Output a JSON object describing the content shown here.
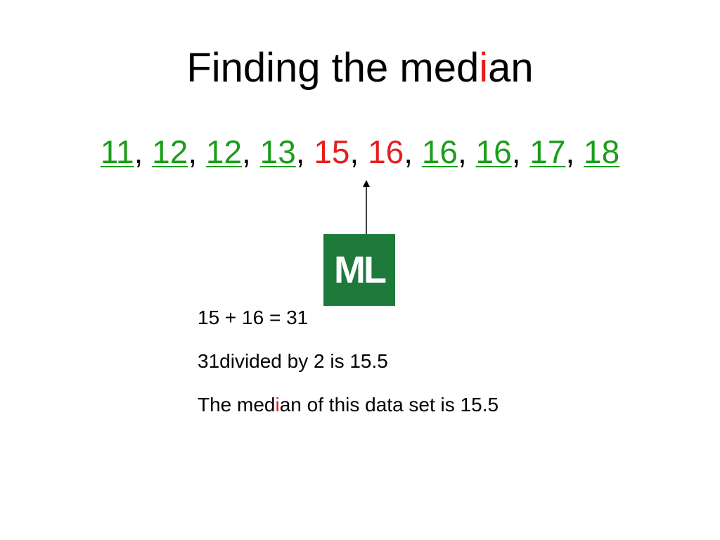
{
  "title": {
    "before": "Finding the med",
    "highlight": "i",
    "after": "an"
  },
  "data_set": {
    "separator": ",",
    "values": [
      {
        "text": "11",
        "median": false
      },
      {
        "text": "12",
        "median": false
      },
      {
        "text": "12",
        "median": false
      },
      {
        "text": "13",
        "median": false
      },
      {
        "text": "15",
        "median": true
      },
      {
        "text": "16",
        "median": true
      },
      {
        "text": "16",
        "median": false
      },
      {
        "text": "16",
        "median": false
      },
      {
        "text": "17",
        "median": false
      },
      {
        "text": "18",
        "median": false
      }
    ]
  },
  "logo": {
    "text": "ML",
    "color": "#1e7a3a"
  },
  "steps": {
    "step1": "15 + 16 = 31",
    "step2": "31divided by 2 is 15.5",
    "step3": {
      "before": "The med",
      "highlight": "i",
      "after": "an of this data set is 15.5"
    }
  },
  "colors": {
    "non_median": "#1a9e1a",
    "median": "#e61e1e",
    "text": "#000000"
  }
}
